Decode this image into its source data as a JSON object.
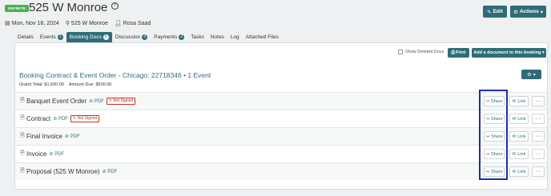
{
  "header": {
    "status_badge": "DEFINITE",
    "title": "525 W Monroe",
    "help_glyph": "?",
    "date": "Mon, Nov 18, 2024",
    "location": "525 W Monroe",
    "owner": "Rosa Saad",
    "edit_label": "Edit",
    "actions_label": "Actions"
  },
  "tabs": [
    {
      "label": "Details",
      "count": ""
    },
    {
      "label": "Events",
      "count": "1"
    },
    {
      "label": "Booking Docs",
      "count": "5",
      "active": true
    },
    {
      "label": "Discussion",
      "count": "3"
    },
    {
      "label": "Payments",
      "count": "2"
    },
    {
      "label": "Tasks",
      "count": ""
    },
    {
      "label": "Notes",
      "count": ""
    },
    {
      "label": "Log",
      "count": ""
    },
    {
      "label": "Attached Files",
      "count": ""
    }
  ],
  "toolbar": {
    "show_deleted_label": "Show Deleted Docs",
    "print_label": "Print",
    "add_doc_label": "Add a document to this booking"
  },
  "contract": {
    "title": "Booking Contract & Event Order - Chicago: 22718346 • 1 Event",
    "grand_total": "Grand Total: $1,500.00",
    "amount_due": "Amount Due: $500.00"
  },
  "documents": [
    {
      "name": "Banquet Event Order",
      "pdf": "PDF",
      "status": "Not Signed"
    },
    {
      "name": "Contract",
      "pdf": "PDF",
      "status": "Not Signed"
    },
    {
      "name": "Final Invoice",
      "pdf": "PDF",
      "status": ""
    },
    {
      "name": "Invoice",
      "pdf": "PDF",
      "status": ""
    },
    {
      "name": "Proposal (525 W Monroe)",
      "pdf": "PDF",
      "status": ""
    }
  ],
  "row_actions": {
    "share_label": "Share",
    "link_label": "Link",
    "more_label": "···"
  },
  "colors": {
    "accent": "#2e6d77",
    "definite_badge": "#4caf50",
    "not_signed": "#c0392b",
    "highlight_box": "#1d2fb0"
  }
}
